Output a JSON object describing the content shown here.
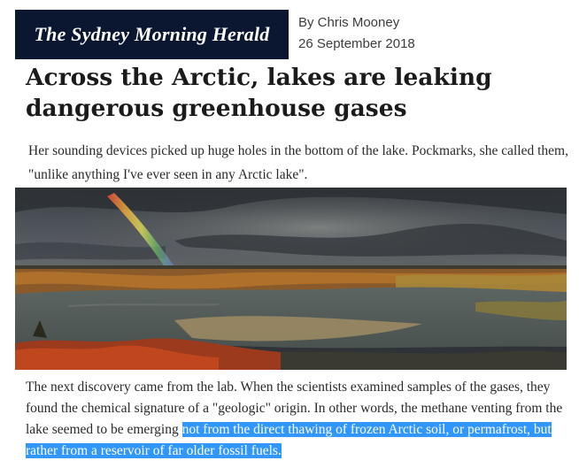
{
  "masthead": {
    "logo_text": "The Sydney Morning Herald",
    "brand_color": "#0b1730"
  },
  "byline": {
    "author": "By Chris Mooney",
    "date": "26 September 2018"
  },
  "article": {
    "headline": "Across the Arctic, lakes are leaking dangerous greenhouse gases",
    "intro": "Her sounding devices picked up huge holes in the bottom of the lake. Pockmarks, she called them, \"unlike anything I've ever seen in any Arctic lake\".",
    "image_icon": "landscape-photo-icon",
    "body_plain": "The next discovery came from the lab. When the scientists examined samples of the gases, they found the chemical signature of a \"geologic\" origin. In other words, the methane venting from the lake seemed to be emerging ",
    "body_highlighted": "not from the direct thawing of frozen Arctic soil, or permafrost, but rather from a reservoir of far older fossil fuels.",
    "selection_color": "#3297fd"
  }
}
